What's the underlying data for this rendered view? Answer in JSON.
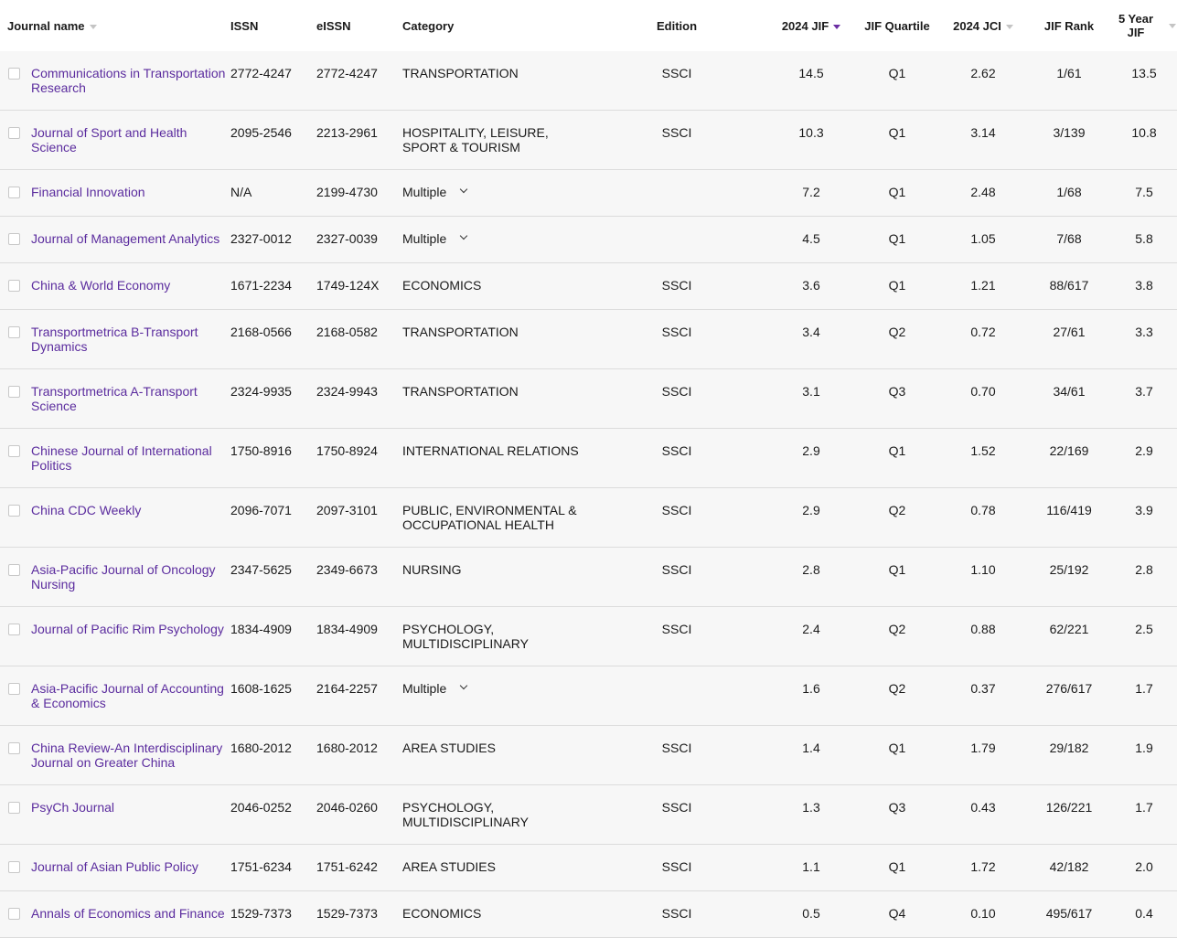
{
  "columns": {
    "journal_name": "Journal name",
    "issn": "ISSN",
    "eissn": "eISSN",
    "category": "Category",
    "edition": "Edition",
    "jif": "2024 JIF",
    "quartile": "JIF Quartile",
    "jci": "2024 JCI",
    "rank": "JIF Rank",
    "five_year_line1": "5 Year",
    "five_year_line2": "JIF"
  },
  "icons": {
    "sort": "sort-caret-down-icon",
    "sort_active_color": "#6b2ea3",
    "link_color": "#5b2c9e",
    "category_expand": "chevron-down-icon"
  },
  "rows": [
    {
      "name": "Communications in Transportation Research",
      "issn": "2772-4247",
      "eissn": "2772-4247",
      "category": "TRANSPORTATION",
      "multiple": false,
      "edition": "SSCI",
      "jif": "14.5",
      "quartile": "Q1",
      "jci": "2.62",
      "rank": "1/61",
      "five_year": "13.5"
    },
    {
      "name": "Journal of Sport and Health Science",
      "issn": "2095-2546",
      "eissn": "2213-2961",
      "category": "HOSPITALITY, LEISURE, SPORT & TOURISM",
      "multiple": false,
      "edition": "SSCI",
      "jif": "10.3",
      "quartile": "Q1",
      "jci": "3.14",
      "rank": "3/139",
      "five_year": "10.8"
    },
    {
      "name": "Financial Innovation",
      "issn": "N/A",
      "eissn": "2199-4730",
      "category": "Multiple",
      "multiple": true,
      "edition": "",
      "jif": "7.2",
      "quartile": "Q1",
      "jci": "2.48",
      "rank": "1/68",
      "five_year": "7.5"
    },
    {
      "name": "Journal of Management Analytics",
      "issn": "2327-0012",
      "eissn": "2327-0039",
      "category": "Multiple",
      "multiple": true,
      "edition": "",
      "jif": "4.5",
      "quartile": "Q1",
      "jci": "1.05",
      "rank": "7/68",
      "five_year": "5.8"
    },
    {
      "name": "China & World Economy",
      "issn": "1671-2234",
      "eissn": "1749-124X",
      "category": "ECONOMICS",
      "multiple": false,
      "edition": "SSCI",
      "jif": "3.6",
      "quartile": "Q1",
      "jci": "1.21",
      "rank": "88/617",
      "five_year": "3.8"
    },
    {
      "name": "Transportmetrica B-Transport Dynamics",
      "issn": "2168-0566",
      "eissn": "2168-0582",
      "category": "TRANSPORTATION",
      "multiple": false,
      "edition": "SSCI",
      "jif": "3.4",
      "quartile": "Q2",
      "jci": "0.72",
      "rank": "27/61",
      "five_year": "3.3"
    },
    {
      "name": "Transportmetrica A-Transport Science",
      "issn": "2324-9935",
      "eissn": "2324-9943",
      "category": "TRANSPORTATION",
      "multiple": false,
      "edition": "SSCI",
      "jif": "3.1",
      "quartile": "Q3",
      "jci": "0.70",
      "rank": "34/61",
      "five_year": "3.7"
    },
    {
      "name": "Chinese Journal of International Politics",
      "issn": "1750-8916",
      "eissn": "1750-8924",
      "category": "INTERNATIONAL RELATIONS",
      "multiple": false,
      "edition": "SSCI",
      "jif": "2.9",
      "quartile": "Q1",
      "jci": "1.52",
      "rank": "22/169",
      "five_year": "2.9"
    },
    {
      "name": "China CDC Weekly",
      "issn": "2096-7071",
      "eissn": "2097-3101",
      "category": "PUBLIC, ENVIRONMENTAL & OCCUPATIONAL HEALTH",
      "multiple": false,
      "edition": "SSCI",
      "jif": "2.9",
      "quartile": "Q2",
      "jci": "0.78",
      "rank": "116/419",
      "five_year": "3.9"
    },
    {
      "name": "Asia-Pacific Journal of Oncology Nursing",
      "issn": "2347-5625",
      "eissn": "2349-6673",
      "category": "NURSING",
      "multiple": false,
      "edition": "SSCI",
      "jif": "2.8",
      "quartile": "Q1",
      "jci": "1.10",
      "rank": "25/192",
      "five_year": "2.8"
    },
    {
      "name": "Journal of Pacific Rim Psychology",
      "issn": "1834-4909",
      "eissn": "1834-4909",
      "category": "PSYCHOLOGY, MULTIDISCIPLINARY",
      "multiple": false,
      "edition": "SSCI",
      "jif": "2.4",
      "quartile": "Q2",
      "jci": "0.88",
      "rank": "62/221",
      "five_year": "2.5"
    },
    {
      "name": "Asia-Pacific Journal of Accounting & Economics",
      "issn": "1608-1625",
      "eissn": "2164-2257",
      "category": "Multiple",
      "multiple": true,
      "edition": "",
      "jif": "1.6",
      "quartile": "Q2",
      "jci": "0.37",
      "rank": "276/617",
      "five_year": "1.7"
    },
    {
      "name": "China Review-An Interdisciplinary Journal on Greater China",
      "issn": "1680-2012",
      "eissn": "1680-2012",
      "category": "AREA STUDIES",
      "multiple": false,
      "edition": "SSCI",
      "jif": "1.4",
      "quartile": "Q1",
      "jci": "1.79",
      "rank": "29/182",
      "five_year": "1.9"
    },
    {
      "name": "PsyCh Journal",
      "issn": "2046-0252",
      "eissn": "2046-0260",
      "category": "PSYCHOLOGY, MULTIDISCIPLINARY",
      "multiple": false,
      "edition": "SSCI",
      "jif": "1.3",
      "quartile": "Q3",
      "jci": "0.43",
      "rank": "126/221",
      "five_year": "1.7"
    },
    {
      "name": "Journal of Asian Public Policy",
      "issn": "1751-6234",
      "eissn": "1751-6242",
      "category": "AREA STUDIES",
      "multiple": false,
      "edition": "SSCI",
      "jif": "1.1",
      "quartile": "Q1",
      "jci": "1.72",
      "rank": "42/182",
      "five_year": "2.0"
    },
    {
      "name": "Annals of Economics and Finance",
      "issn": "1529-7373",
      "eissn": "1529-7373",
      "category": "ECONOMICS",
      "multiple": false,
      "edition": "SSCI",
      "jif": "0.5",
      "quartile": "Q4",
      "jci": "0.10",
      "rank": "495/617",
      "five_year": "0.4"
    }
  ]
}
